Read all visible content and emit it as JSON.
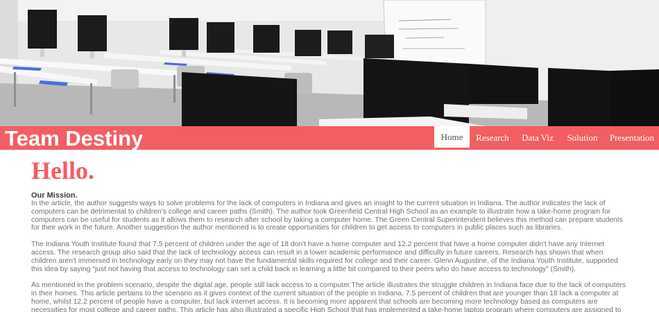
{
  "header": {
    "site_title": "Team Destiny"
  },
  "nav": {
    "items": [
      {
        "label": "Home",
        "active": true
      },
      {
        "label": "Research",
        "active": false
      },
      {
        "label": "Data Viz",
        "active": false
      },
      {
        "label": "Solution",
        "active": false
      },
      {
        "label": "Presentation",
        "active": false
      }
    ]
  },
  "main": {
    "greeting": "Hello.",
    "mission_heading": "Our Mission.",
    "paragraphs": [
      "In the article, the author suggests ways to solve problems for the lack of computers in Indiana and gives an insight to the current situation in Indiana. The author indicates the lack of computers can be detrimental to children's college and career paths (Smith). The author took Greenfield Central High School as an example to illustrate how a take-home program for computers can be useful for students as it allows them to research after school by taking a computer home. The Green Central Superintendent believes this method can prepare students for their work in the future. Another suggestion the author mentioned is to create opportunities for children to get access to computers in public places such as libraries.",
      "The Indiana Youth Institute found that 7.5 percent of children under the age of 18 don't have a home computer and 12.2 percent that have a home computer didn't have any Internet access. The research group also said that the lack of technology access can result in a lower academic performance and difficulty in future careers. Research has shown that when children aren't immersed in technology early on they may not have the fundamental skills required for college and their career. Glenn Augustine, of the Indiana Youth Institute, supported this idea by saying “just not having that access to technology can set a child back in learning a little bit compared to their peers who do have access to technology” (Smith).",
      "As mentioned in the problem scenario, despite the digital age, people still lack access to a computer.The article illustrates the struggle children in Indiana face due to the lack of computers in their homes. This article pertains to the scenario as it gives context of the current situation of the people in Indiana. 7.5 percent of children that are younger than 18 lack a computer at home, whilst 12.2 percent of people have a computer, but lack internet access. It is becoming more apparent that schools are becoming more technology based as computers are necessities for most college and career paths. This article has also illustrated a specific High School that has implemented a take-home laptop program where computers are assigned to students in the beginning of high school. This program has illustrated a possible area where we believe that our solution could solve (Smith)."
    ]
  },
  "colors": {
    "accent": "#f25e61",
    "body_text": "#707070",
    "heading_text": "#3b3b3b",
    "nav_active_bg": "#ffffff"
  }
}
